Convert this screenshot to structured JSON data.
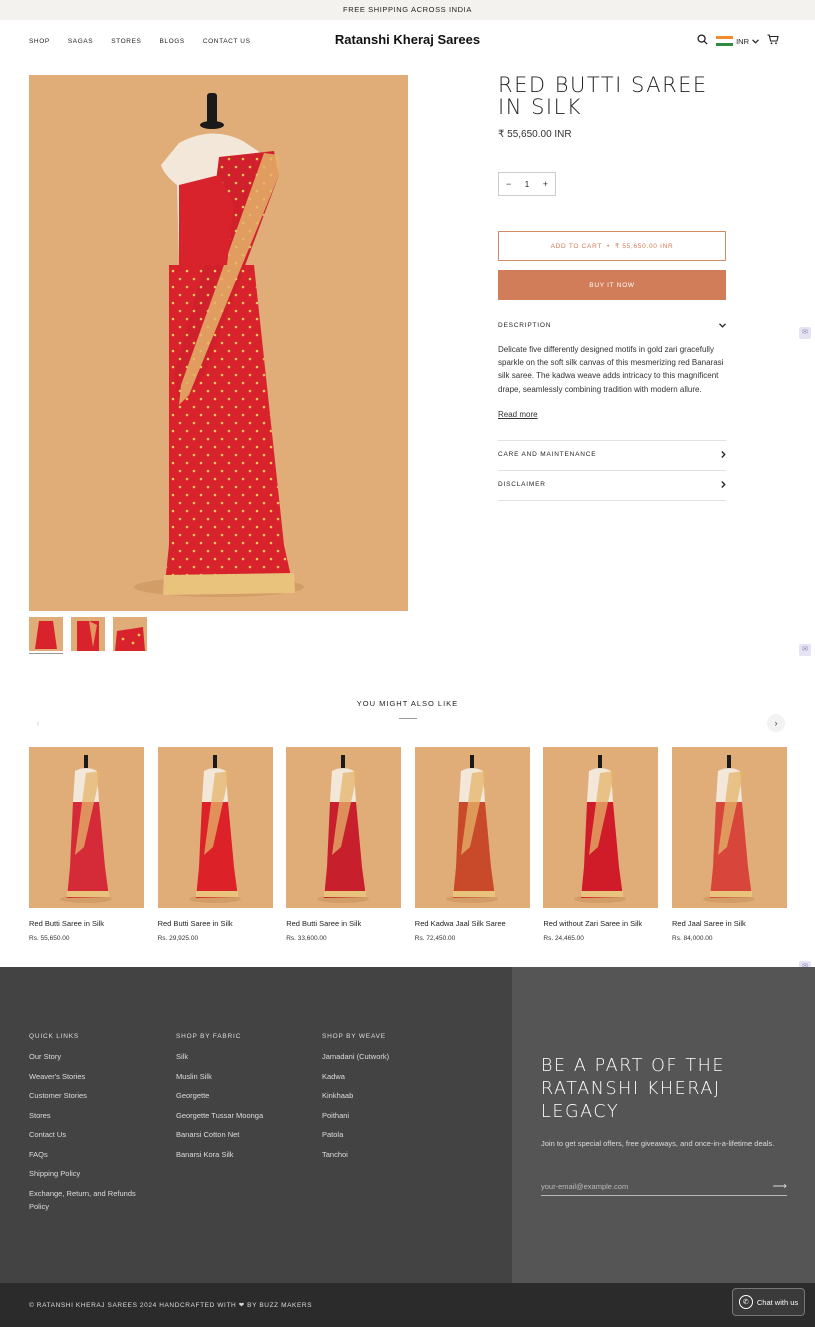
{
  "announcement": "FREE SHIPPING ACROSS INDIA",
  "nav": [
    "SHOP",
    "SAGAS",
    "STORES",
    "BLOGS",
    "CONTACT US"
  ],
  "brand": "Ratanshi Kheraj Sarees",
  "currency": "INR",
  "product": {
    "title": "RED BUTTI SAREE IN SILK",
    "price": "₹ 55,650.00 INR",
    "quantity": "1",
    "add_to_cart": "ADD TO CART",
    "add_to_cart_price": "₹ 55,650.00 INR",
    "buy_now": "BUY IT NOW",
    "description_heading": "DESCRIPTION",
    "description": "Delicate five differently designed motifs in gold zari gracefully sparkle on the soft silk canvas of this mesmerizing red Banarasi silk saree. The kadwa weave adds intricacy to this magnificent drape, seamlessly combining tradition with modern allure.",
    "read_more": "Read more",
    "care_heading": "CARE AND MAINTENANCE",
    "disclaimer_heading": "DISCLAIMER"
  },
  "related": {
    "title": "YOU MIGHT ALSO LIKE",
    "items": [
      {
        "name": "Red Butti Saree in Silk",
        "price": "Rs. 55,650.00",
        "color": "#d52a38"
      },
      {
        "name": "Red Butti Saree in Silk",
        "price": "Rs. 29,925.00",
        "color": "#dc2128"
      },
      {
        "name": "Red Butti Saree in Silk",
        "price": "Rs. 33,600.00",
        "color": "#c81f2c"
      },
      {
        "name": "Red Kadwa Jaal Silk Saree",
        "price": "Rs. 72,450.00",
        "color": "#c94a2a"
      },
      {
        "name": "Red without Zari Saree in Silk",
        "price": "Rs. 24,465.00",
        "color": "#d01c28"
      },
      {
        "name": "Red Jaal Saree in Silk",
        "price": "Rs. 84,000.00",
        "color": "#d8453b"
      }
    ]
  },
  "footer": {
    "quick_links": {
      "heading": "QUICK LINKS",
      "links": [
        "Our Story",
        "Weaver's Stories",
        "Customer Stories",
        "Stores",
        "Contact Us",
        "FAQs",
        "Shipping Policy",
        "Exchange, Return, and Refunds Policy"
      ]
    },
    "fabric": {
      "heading": "SHOP BY FABRIC",
      "links": [
        "Silk",
        "Muslin Silk",
        "Georgette",
        "Georgette Tussar Moonga",
        "Banarsi Cotton Net",
        "Banarsi Kora Silk"
      ]
    },
    "weave": {
      "heading": "SHOP BY WEAVE",
      "links": [
        "Jamadani (Cutwork)",
        "Kadwa",
        "Kinkhaab",
        "Poithani",
        "Patola",
        "Tanchoi"
      ]
    },
    "legacy_title": "BE A PART OF THE RATANSHI KHERAJ LEGACY",
    "legacy_sub": "Join to get special offers, free giveaways, and once-in-a-lifetime deals.",
    "email_placeholder": "your-email@example.com",
    "copyright": "© RATANSHI KHERAJ SAREES 2024   HANDCRAFTED WITH ❤ BY BUZZ MAKERS",
    "chat": "Chat with us"
  },
  "colors": {
    "accent": "#d27d5a",
    "image_bg": "#e0ad78",
    "footer_dark": "#434343",
    "footer_mid": "#555555"
  }
}
